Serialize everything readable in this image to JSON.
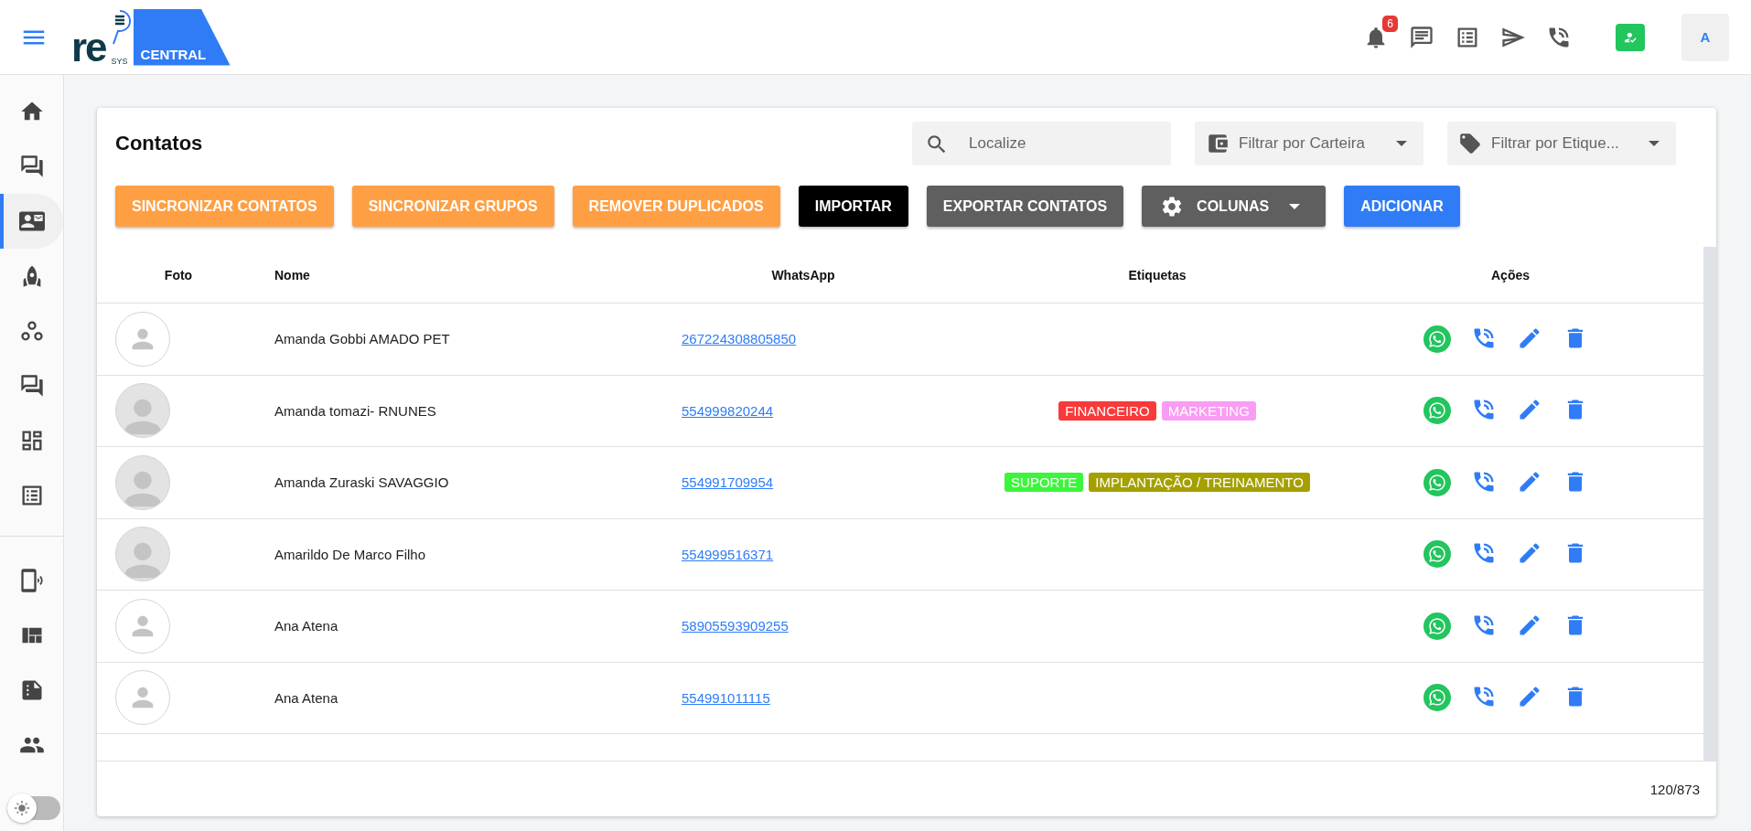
{
  "header": {
    "logo": {
      "wordmark": "re",
      "sub": "SYS",
      "badge": "CENTRAL"
    },
    "notifications": {
      "count": "6"
    },
    "avatar": {
      "initial": "A"
    }
  },
  "sidebar": {
    "sections": [
      {
        "items": [
          {
            "selected": false
          },
          {
            "selected": false
          },
          {
            "selected": true
          },
          {
            "selected": false
          },
          {
            "selected": false
          },
          {
            "selected": false
          },
          {
            "selected": false
          },
          {
            "selected": false
          }
        ]
      },
      {
        "items": [
          {
            "selected": false
          },
          {
            "selected": false
          },
          {
            "selected": false
          },
          {
            "selected": false
          }
        ]
      }
    ],
    "theme_toggle": {
      "on": false
    }
  },
  "page": {
    "title": "Contatos",
    "search": {
      "placeholder": "Localize"
    },
    "filters": [
      {
        "kind": "wallet",
        "placeholder": "Filtrar por Carteira"
      },
      {
        "kind": "tag",
        "placeholder": "Filtrar por Etique..."
      }
    ],
    "buttons": [
      {
        "kind": "plain",
        "label": "SINCRONIZAR CONTATOS",
        "color": "#ff9f43"
      },
      {
        "kind": "plain",
        "label": "SINCRONIZAR GRUPOS",
        "color": "#ff9f43"
      },
      {
        "kind": "plain",
        "label": "REMOVER DUPLICADOS",
        "color": "#ff9f43"
      },
      {
        "kind": "plain",
        "label": "IMPORTAR",
        "color": "#000000"
      },
      {
        "kind": "plain",
        "label": "EXPORTAR CONTATOS",
        "color": "#5f5f5f"
      },
      {
        "kind": "menu",
        "label": "COLUNAS",
        "color": "#5f5f5f"
      },
      {
        "kind": "plain",
        "label": "ADICIONAR",
        "color": "#2f7cf6"
      }
    ]
  },
  "table": {
    "columns": [
      "Foto",
      "Nome",
      "WhatsApp",
      "Etiquetas",
      "Ações"
    ],
    "rows": [
      {
        "kind": "outline",
        "name": "Amanda Gobbi AMADO PET",
        "whatsapp": "267224308805850",
        "tags": []
      },
      {
        "kind": "filled",
        "name": "Amanda tomazi- RNUNES",
        "whatsapp": "554999820244",
        "tags": [
          {
            "label": "FINANCEIRO",
            "color": "#f83a3a"
          },
          {
            "label": "MARKETING",
            "color": "#f99cf3"
          }
        ]
      },
      {
        "kind": "filled",
        "name": "Amanda Zuraski SAVAGGIO",
        "whatsapp": "554991709954",
        "tags": [
          {
            "label": "SUPORTE",
            "color": "#3cf53c"
          },
          {
            "label": "IMPLANTAÇÃO / TREINAMENTO",
            "color": "#a5a000"
          }
        ]
      },
      {
        "kind": "filled",
        "name": "Amarildo De Marco Filho",
        "whatsapp": "554999516371",
        "tags": []
      },
      {
        "kind": "outline",
        "name": "Ana Atena",
        "whatsapp": "58905593909255",
        "tags": []
      },
      {
        "kind": "outline",
        "name": "Ana Atena",
        "whatsapp": "554991011115",
        "tags": []
      }
    ]
  },
  "footer": {
    "count": "120/873"
  }
}
